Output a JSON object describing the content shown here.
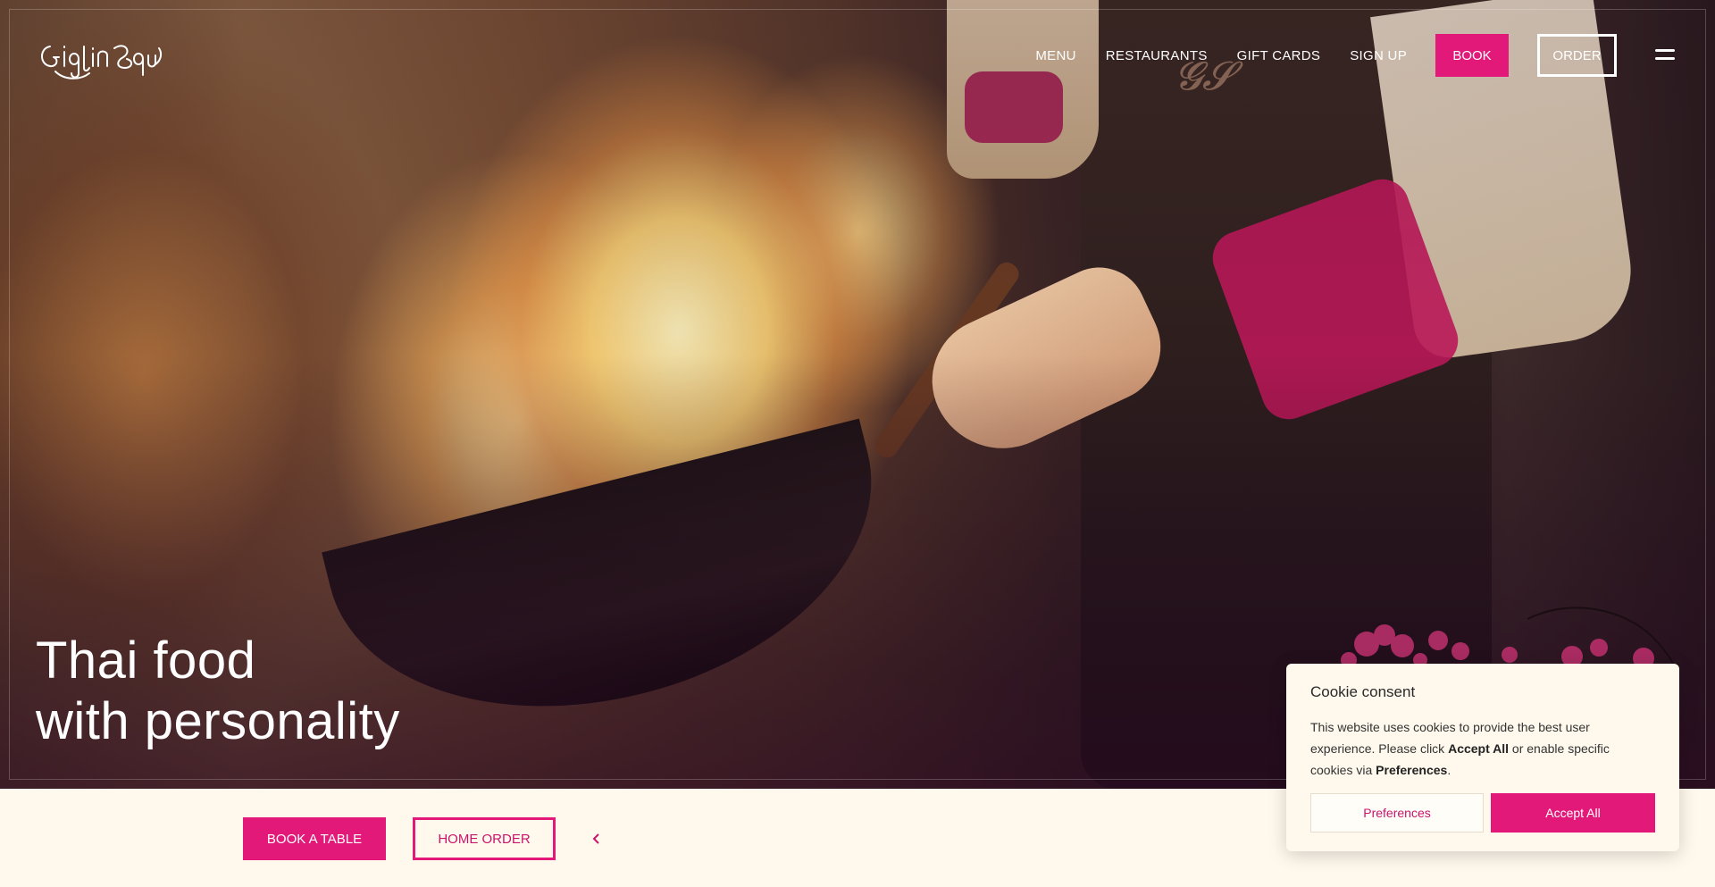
{
  "brand": {
    "name": "Giggling Squid",
    "accent": "#e3197a"
  },
  "nav": {
    "items": [
      "MENU",
      "RESTAURANTS",
      "GIFT CARDS",
      "SIGN UP"
    ],
    "book_label": "BOOK",
    "order_label": "ORDER"
  },
  "hero": {
    "headline_line1": "Thai food",
    "headline_line2": "with personality"
  },
  "bottom_bar": {
    "book_table_label": "BOOK A TABLE",
    "home_order_label": "HOME ORDER",
    "prev_icon": "chevron-left-icon"
  },
  "cookie": {
    "title": "Cookie consent",
    "text_1": "This website uses cookies to provide the best user experience. Please click ",
    "accept_bold": "Accept All",
    "text_2": " or enable specific cookies via ",
    "pref_bold": "Preferences",
    "text_3": ".",
    "preferences_label": "Preferences",
    "accept_label": "Accept All"
  }
}
